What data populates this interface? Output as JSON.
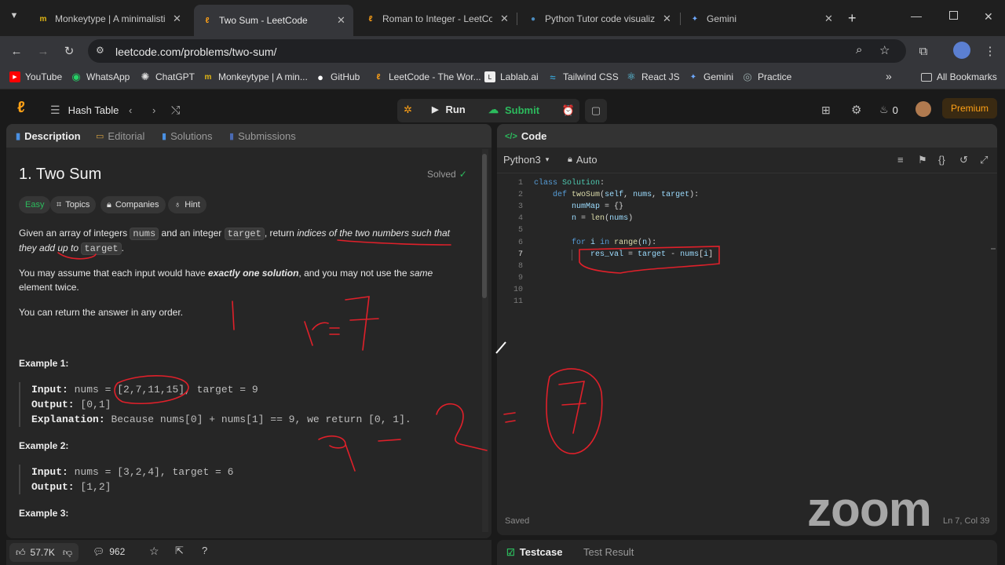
{
  "browser": {
    "tabs": [
      {
        "label": "Monkeytype | A minimalistic",
        "icon": "monkeytype-icon"
      },
      {
        "label": "Two Sum - LeetCode",
        "icon": "leetcode-icon",
        "active": true
      },
      {
        "label": "Roman to Integer - LeetCode",
        "icon": "leetcode-icon"
      },
      {
        "label": "Python Tutor code visualize",
        "icon": "python-icon"
      },
      {
        "label": "Gemini",
        "icon": "gemini-icon"
      }
    ],
    "url": "leetcode.com/problems/two-sum/",
    "bookmarks": [
      "YouTube",
      "WhatsApp",
      "ChatGPT",
      "Monkeytype | A min...",
      "GitHub",
      "LeetCode - The Wor...",
      "Lablab.ai",
      "Tailwind CSS",
      "React JS",
      "Gemini",
      "Practice"
    ],
    "all_bookmarks": "All Bookmarks"
  },
  "lc_header": {
    "list_label": "Hash Table",
    "run": "Run",
    "submit": "Submit",
    "streak": "0",
    "premium": "Premium"
  },
  "desc_tabs": [
    "Description",
    "Editorial",
    "Solutions",
    "Submissions"
  ],
  "problem": {
    "title": "1. Two Sum",
    "status": "Solved",
    "difficulty": "Easy",
    "chips": [
      "Topics",
      "Companies",
      "Hint"
    ],
    "p1_a": "Given an array of integers ",
    "p1_nums": "nums",
    "p1_b": " and an integer ",
    "p1_target": "target",
    "p1_c": ", return ",
    "p1_italic": "indices of the two numbers such that they add up to",
    "p1_target2": "target",
    "p1_end": ".",
    "p2_a": "You may assume that each input would have ",
    "p2_bold": "exactly one solution",
    "p2_b": ", and you may not use the ",
    "p2_italic": "same",
    "p2_c": " element twice.",
    "p3": "You can return the answer in any order.",
    "examples": [
      {
        "heading": "Example 1:",
        "input": "nums = [2,7,11,15], target = 9",
        "output": "[0,1]",
        "explanation": "Because nums[0] + nums[1] == 9, we return [0, 1]."
      },
      {
        "heading": "Example 2:",
        "input": "nums = [3,2,4], target = 6",
        "output": "[1,2]"
      },
      {
        "heading": "Example 3:"
      }
    ],
    "labels": {
      "input": "Input:",
      "output": "Output:",
      "explanation": "Explanation:"
    }
  },
  "bottom": {
    "likes": "57.7K",
    "comments": "962"
  },
  "code_panel": {
    "title": "Code",
    "language": "Python3",
    "mode": "Auto",
    "saved": "Saved",
    "cursor": "Ln 7, Col 39",
    "line_numbers": [
      "1",
      "2",
      "3",
      "4",
      "5",
      "6",
      "7",
      "8",
      "9",
      "10",
      "11"
    ]
  },
  "test_tabs": [
    "Testcase",
    "Test Result"
  ],
  "overlay": {
    "zoom": "zoom"
  },
  "colors": {
    "submit_green": "#2cbb5d",
    "premium": "#ffa116",
    "annotation_red": "#e0202a"
  }
}
